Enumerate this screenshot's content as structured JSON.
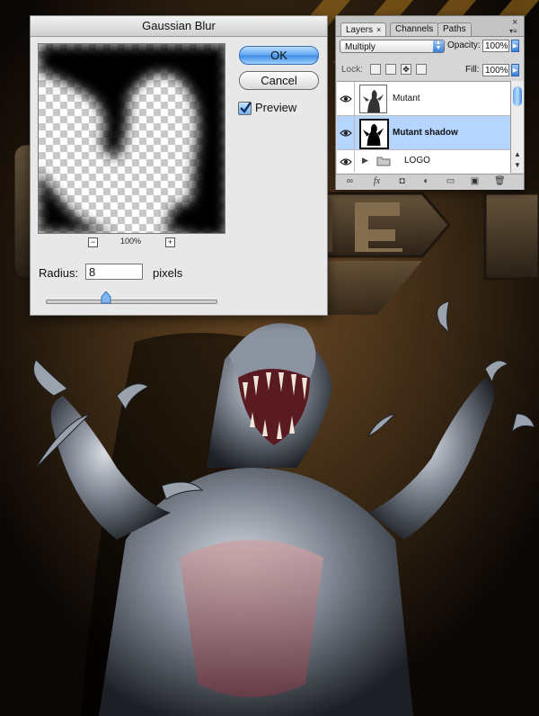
{
  "dialog": {
    "title": "Gaussian Blur",
    "ok_label": "OK",
    "cancel_label": "Cancel",
    "preview_label": "Preview",
    "preview_checked": true,
    "zoom_out_symbol": "−",
    "zoom_in_symbol": "+",
    "zoom_value": "100%",
    "radius_label": "Radius:",
    "radius_value": "8",
    "radius_units": "pixels",
    "radius_slider_fraction": 0.36
  },
  "layers_panel": {
    "tabs": [
      {
        "label": "Layers",
        "active": true,
        "close_symbol": "×"
      },
      {
        "label": "Channels",
        "active": false
      },
      {
        "label": "Paths",
        "active": false
      }
    ],
    "panel_close_symbol": "×",
    "blend_mode": "Multiply",
    "opacity_label": "Opacity:",
    "opacity_value": "100%",
    "lock_label": "Lock:",
    "fill_label": "Fill:",
    "fill_value": "100%",
    "layers": [
      {
        "name": "Mutant",
        "visible": true,
        "selected": false
      },
      {
        "name": "Mutant shadow",
        "visible": true,
        "selected": true
      },
      {
        "name": "LOGO",
        "visible": true,
        "selected": false,
        "type": "group"
      }
    ],
    "footer_icons": [
      "link-icon",
      "fx-icon",
      "mask-icon",
      "adjustment-icon",
      "folder-icon",
      "new-layer-icon",
      "trash-icon"
    ],
    "fx_text": "fx"
  },
  "colors": {
    "selection_blue": "#b5d5ff",
    "aqua_button": "#3b8be4",
    "background": "#0a0806"
  }
}
